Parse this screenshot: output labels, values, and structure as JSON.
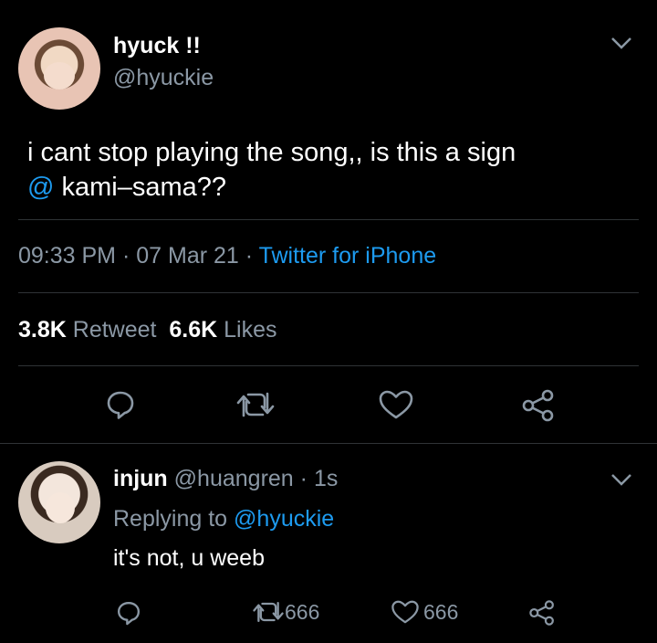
{
  "tweet": {
    "display_name": "hyuck !!",
    "handle": "@hyuckie",
    "text_line1": "i cant stop playing the song,, is this a sign",
    "mention": "@",
    "text_line2_rest": " kami–sama??",
    "time": "09:33 PM",
    "sep1": "·",
    "date": "07 Mar 21",
    "sep2": "·",
    "source": "Twitter for iPhone",
    "retweets_count": "3.8K",
    "retweets_label": "Retweet",
    "likes_count": "6.6K",
    "likes_label": "Likes"
  },
  "reply": {
    "display_name": "injun",
    "handle": "@huangren",
    "sep": "·",
    "time": "1s",
    "replying_prefix": "Replying to",
    "replying_to": "@hyuckie",
    "text": "it's not, u weeb",
    "retweet_count": "666",
    "like_count": "666"
  },
  "colors": {
    "background": "#000000",
    "accent": "#1d9bf0",
    "muted": "#8b98a5",
    "divider": "#2f3336"
  },
  "icons": [
    "chevron-down-icon",
    "reply-icon",
    "retweet-icon",
    "like-icon",
    "share-icon"
  ]
}
